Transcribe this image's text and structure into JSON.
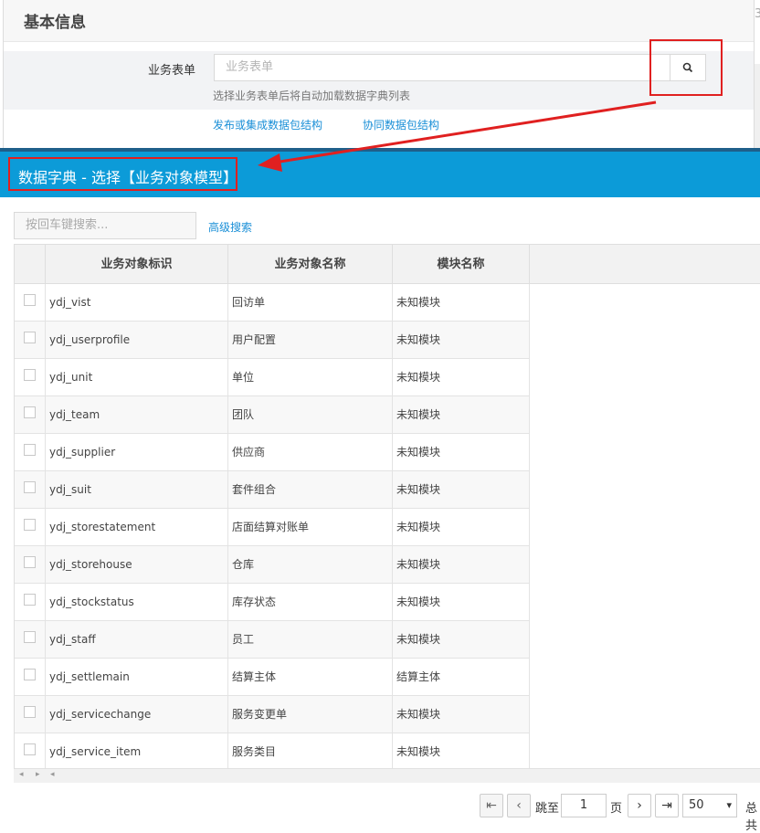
{
  "top": {
    "title": "基本信息",
    "field_label": "业务表单",
    "field_placeholder": "业务表单",
    "hint": "选择业务表单后将自动加载数据字典列表",
    "link1": "发布或集成数据包结构",
    "link2": "协同数据包结构",
    "edge_digit": "3"
  },
  "dialog": {
    "title": "数据字典 - 选择【业务对象模型】",
    "search_placeholder": "按回车键搜索...",
    "advanced_search": "高级搜索",
    "columns": [
      "业务对象标识",
      "业务对象名称",
      "模块名称"
    ],
    "rows": [
      {
        "id": "ydj_vist",
        "name": "回访单",
        "module": "未知模块"
      },
      {
        "id": "ydj_userprofile",
        "name": "用户配置",
        "module": "未知模块"
      },
      {
        "id": "ydj_unit",
        "name": "单位",
        "module": "未知模块"
      },
      {
        "id": "ydj_team",
        "name": "团队",
        "module": "未知模块"
      },
      {
        "id": "ydj_supplier",
        "name": "供应商",
        "module": "未知模块"
      },
      {
        "id": "ydj_suit",
        "name": "套件组合",
        "module": "未知模块"
      },
      {
        "id": "ydj_storestatement",
        "name": "店面结算对账单",
        "module": "未知模块"
      },
      {
        "id": "ydj_storehouse",
        "name": "仓库",
        "module": "未知模块"
      },
      {
        "id": "ydj_stockstatus",
        "name": "库存状态",
        "module": "未知模块"
      },
      {
        "id": "ydj_staff",
        "name": "员工",
        "module": "未知模块"
      },
      {
        "id": "ydj_settlemain",
        "name": "结算主体",
        "module": "结算主体"
      },
      {
        "id": "ydj_servicechange",
        "name": "服务变更单",
        "module": "未知模块"
      },
      {
        "id": "ydj_service_item",
        "name": "服务类目",
        "module": "未知模块"
      }
    ]
  },
  "pager": {
    "goto_label": "跳至",
    "page_value": "1",
    "page_unit": "页",
    "page_size": "50",
    "total_label": "总共"
  },
  "colors": {
    "title_bar": "#0c9bd8",
    "highlight": "#e02020",
    "link": "#1a8fd7"
  }
}
